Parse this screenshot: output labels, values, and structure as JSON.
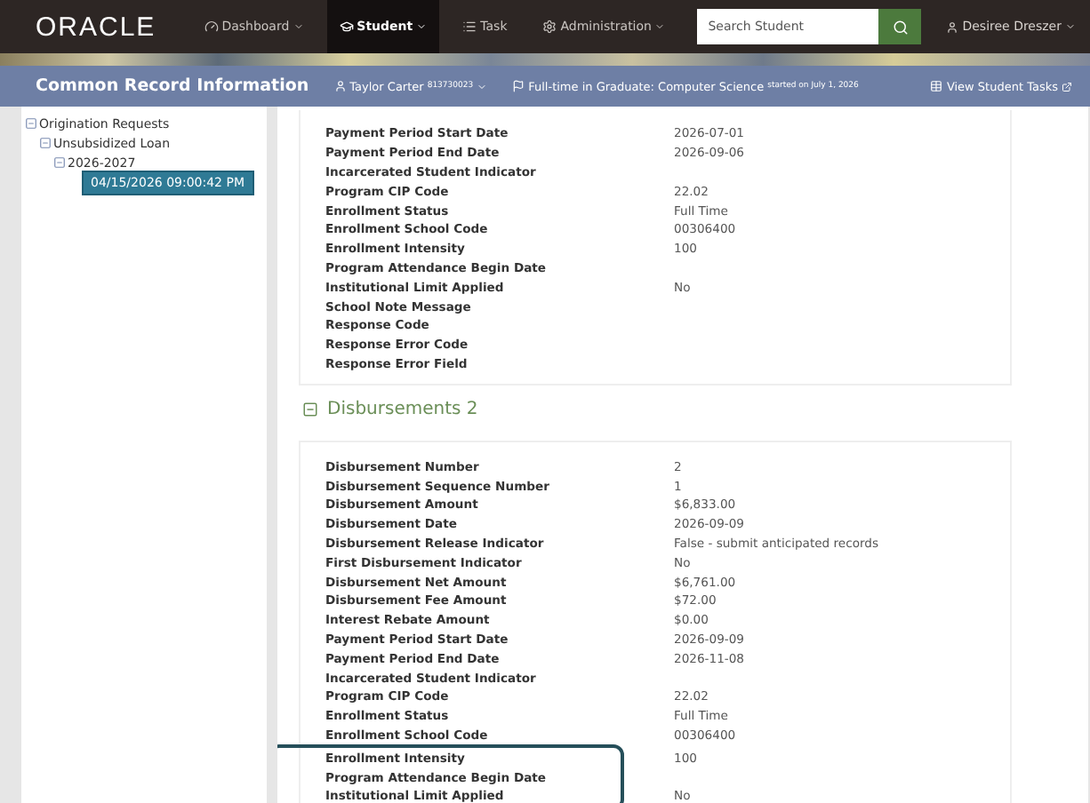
{
  "nav": {
    "logo": "ORACLE",
    "items": [
      {
        "label": "Dashboard",
        "selected": false
      },
      {
        "label": "Student",
        "selected": true
      },
      {
        "label": "Task",
        "selected": false
      },
      {
        "label": "Administration",
        "selected": false
      }
    ],
    "search": {
      "placeholder": "Search Student"
    },
    "user": "Desiree Dreszer"
  },
  "header": {
    "title": "Common Record Information",
    "student": "Taylor Carter",
    "student_id": "813730023",
    "program": "Full-time in Graduate: Computer Science",
    "program_note": "started on July 1, 2026",
    "tasks_link": "View Student Tasks"
  },
  "tree": [
    {
      "label": "Origination Requests",
      "expanded": true,
      "children": [
        {
          "label": "Unsubsidized Loan",
          "expanded": true,
          "children": [
            {
              "label": "2026-2027",
              "expanded": true,
              "children": [
                {
                  "label": "04/15/2026 09:00:42 PM",
                  "selected": true
                }
              ]
            }
          ]
        }
      ]
    }
  ],
  "sections": [
    {
      "rows": [
        {
          "label": "Payment Period Start Date",
          "value": "2026-07-01",
          "highlighted": false
        },
        {
          "label": "Payment Period End Date",
          "value": "2026-09-06",
          "highlighted": false
        },
        {
          "label": "Incarcerated Student Indicator",
          "highlighted": false
        },
        {
          "label": "Program CIP Code",
          "value": "22.02",
          "highlighted": false
        },
        {
          "label": "Enrollment Status",
          "value": "Full Time",
          "highlighted": false
        },
        {
          "label": "Enrollment School Code",
          "value": "00306400",
          "highlighted": false
        },
        {
          "label": "Enrollment Intensity",
          "value": "100",
          "highlighted": false
        },
        {
          "label": "Program Attendance Begin Date",
          "highlighted": false
        },
        {
          "label": "Institutional Limit Applied",
          "value": "No",
          "highlighted": false
        },
        {
          "label": "School Note Message",
          "highlighted": false
        },
        {
          "label": "Response Code",
          "highlighted": false
        },
        {
          "label": "Response Error Code",
          "highlighted": false
        },
        {
          "label": "Response Error Field",
          "highlighted": false
        }
      ]
    },
    {
      "title": "Disbursements 2",
      "expanded": true,
      "rows": [
        {
          "label": "Disbursement Number",
          "value": "2",
          "highlighted": false
        },
        {
          "label": "Disbursement Sequence Number",
          "value": "1",
          "highlighted": false
        },
        {
          "label": "Disbursement Amount",
          "value": "$6,833.00",
          "highlighted": false
        },
        {
          "label": "Disbursement Date",
          "value": "2026-09-09",
          "highlighted": false
        },
        {
          "label": "Disbursement Release Indicator",
          "value": "False - submit anticipated records",
          "highlighted": false
        },
        {
          "label": "First Disbursement Indicator",
          "value": "No",
          "highlighted": false
        },
        {
          "label": "Disbursement Net Amount",
          "value": "$6,761.00",
          "highlighted": false
        },
        {
          "label": "Disbursement Fee Amount",
          "value": "$72.00",
          "highlighted": false
        },
        {
          "label": "Interest Rebate Amount",
          "value": "$0.00",
          "highlighted": false
        },
        {
          "label": "Payment Period Start Date",
          "value": "2026-09-09",
          "highlighted": false
        },
        {
          "label": "Payment Period End Date",
          "value": "2026-11-08",
          "highlighted": false
        },
        {
          "label": "Incarcerated Student Indicator",
          "highlighted": false
        },
        {
          "label": "Program CIP Code",
          "value": "22.02",
          "highlighted": false
        },
        {
          "label": "Enrollment Status",
          "value": "Full Time",
          "highlighted": false
        },
        {
          "label": "Enrollment School Code",
          "value": "00306400",
          "highlighted": false
        },
        {
          "label": "Enrollment Intensity",
          "value": "100",
          "highlighted": true
        },
        {
          "label": "Program Attendance Begin Date",
          "highlighted": true
        },
        {
          "label": "Institutional Limit Applied",
          "value": "No",
          "highlighted": true
        }
      ]
    }
  ]
}
